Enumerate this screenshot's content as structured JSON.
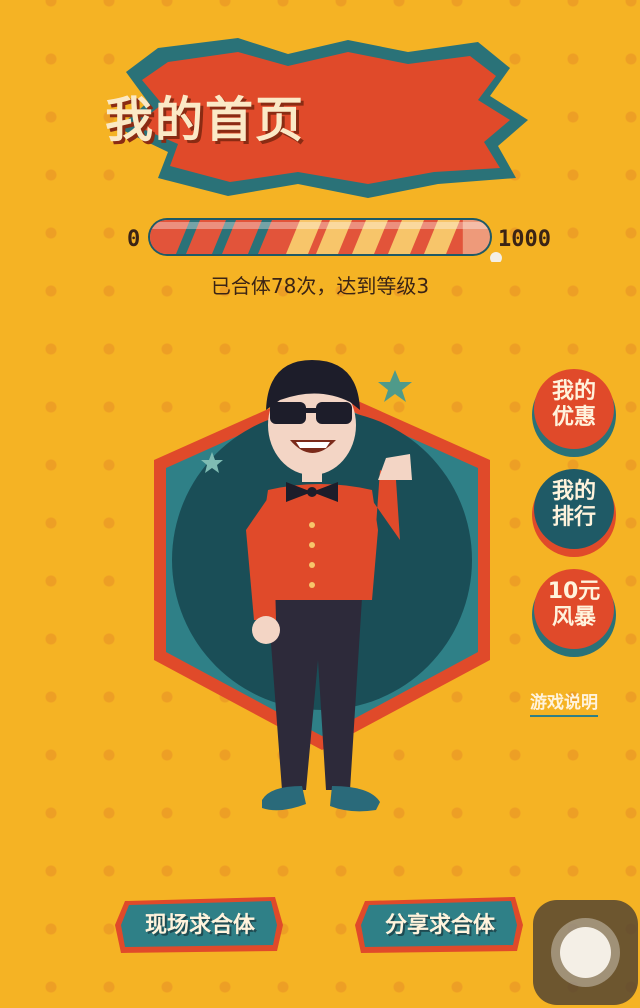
{
  "header": {
    "title": "我的首页"
  },
  "progress": {
    "min_label": "0",
    "max_label": "1000",
    "fraction": 0.92,
    "caption": "已合体78次，达到等级3"
  },
  "side_buttons": [
    {
      "label_line1": "我的",
      "label_line2": "优惠",
      "color": "#e04a2a"
    },
    {
      "label_line1": "我的",
      "label_line2": "排行",
      "color": "#1f5a66"
    },
    {
      "label_line1": "10元",
      "label_line2": "风暴",
      "color": "#e04a2a"
    }
  ],
  "rules_link": "游戏说明",
  "bottom_buttons": {
    "left": "现场求合体",
    "right": "分享求合体"
  },
  "colors": {
    "background": "#f5b324",
    "accent_red": "#e04a2a",
    "accent_teal": "#2f7f86",
    "dark_teal": "#1f5a66"
  },
  "icons": {
    "home": "assistive-touch-icon"
  }
}
